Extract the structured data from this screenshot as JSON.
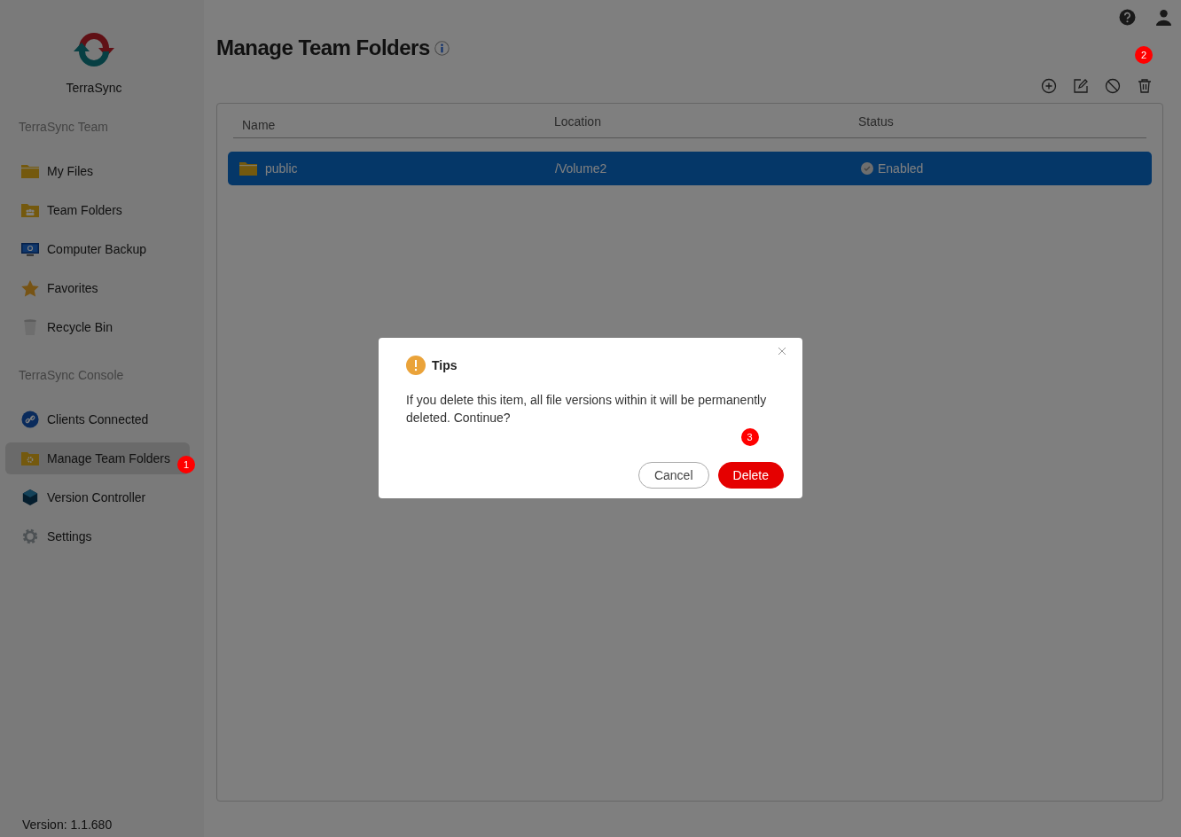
{
  "brand": {
    "name": "TerraSync"
  },
  "sidebar": {
    "sections": [
      {
        "title": "TerraSync Team",
        "items": [
          {
            "label": "My Files",
            "kind": "folder",
            "selected": false
          },
          {
            "label": "Team Folders",
            "kind": "team-folder",
            "selected": false
          },
          {
            "label": "Computer Backup",
            "kind": "monitor",
            "selected": false
          },
          {
            "label": "Favorites",
            "kind": "star",
            "selected": false
          },
          {
            "label": "Recycle Bin",
            "kind": "bin",
            "selected": false
          }
        ]
      },
      {
        "title": "TerraSync Console",
        "items": [
          {
            "label": "Clients Connected",
            "kind": "link",
            "selected": false
          },
          {
            "label": "Manage Team Folders",
            "kind": "gear-folder",
            "selected": true,
            "badge": "1"
          },
          {
            "label": "Version Controller",
            "kind": "cube",
            "selected": false
          },
          {
            "label": "Settings",
            "kind": "gear",
            "selected": false
          }
        ]
      }
    ]
  },
  "version": "Version: 1.1.680",
  "page": {
    "title": "Manage Team Folders"
  },
  "toolbar": {
    "badge": "2"
  },
  "table": {
    "columns": [
      "Name",
      "Location",
      "Status"
    ],
    "rows": [
      {
        "name": "public",
        "location": "/Volume2",
        "status": "Enabled",
        "selected": true
      }
    ]
  },
  "dialog": {
    "title": "Tips",
    "message": "If you delete this item, all file versions within it will be permanently deleted. Continue?",
    "badge": "3",
    "buttons": [
      {
        "label": "Cancel",
        "kind": "secondary"
      },
      {
        "label": "Delete",
        "kind": "danger"
      }
    ]
  }
}
